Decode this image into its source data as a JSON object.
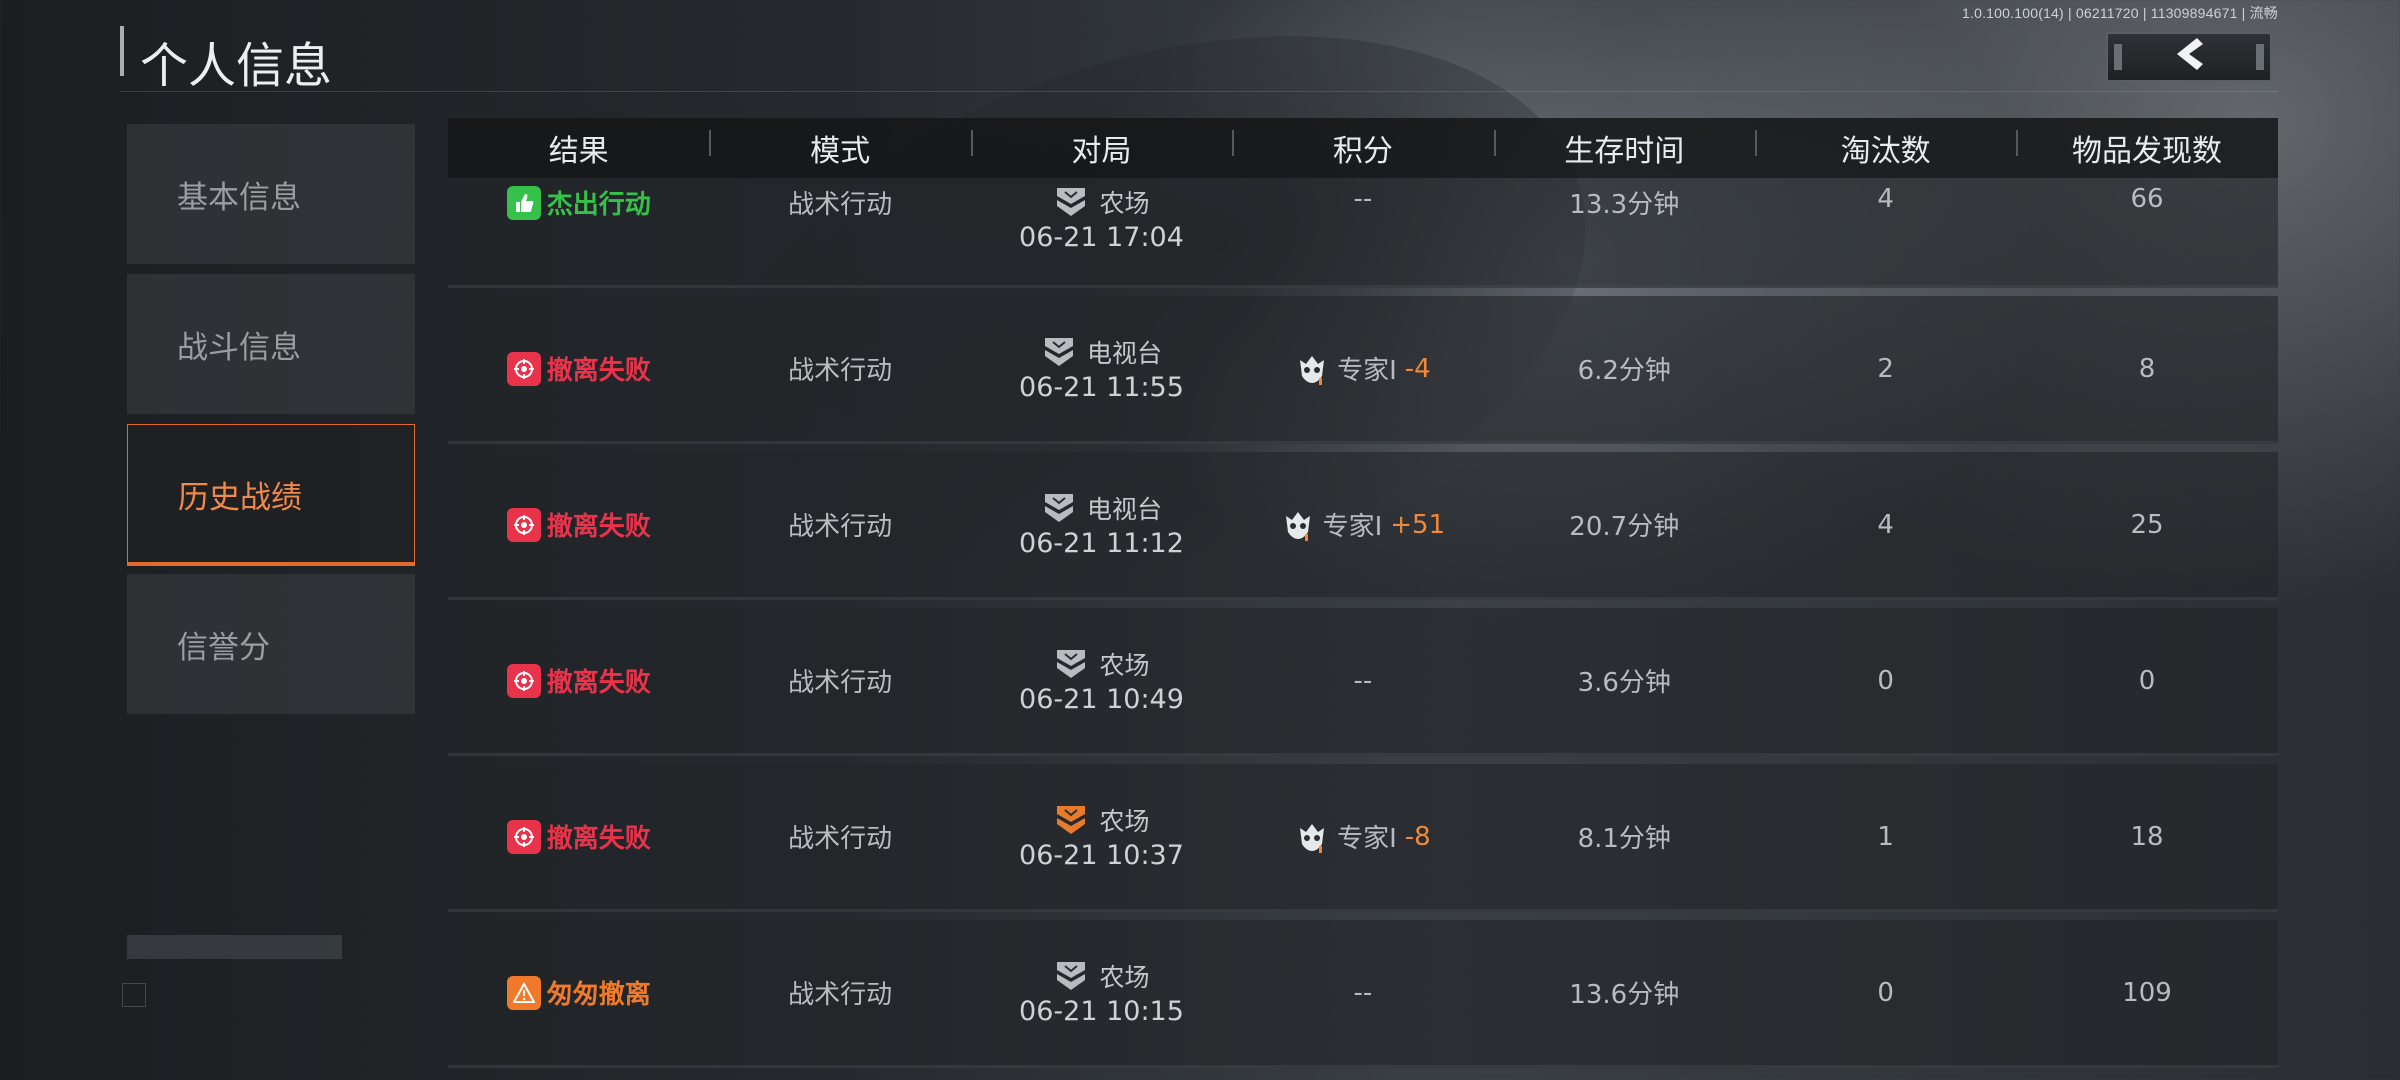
{
  "version_text": "1.0.100.100(14) | 06211720 | 11309894671 | 流畅",
  "header": {
    "title": "个人信息",
    "back_icon": "chevron-left-icon"
  },
  "sidebar": {
    "items": [
      {
        "label": "基本信息",
        "active": false
      },
      {
        "label": "战斗信息",
        "active": false
      },
      {
        "label": "历史战绩",
        "active": true
      },
      {
        "label": "信誉分",
        "active": false
      }
    ]
  },
  "table": {
    "headers": [
      "结果",
      "模式",
      "对局",
      "积分",
      "生存时间",
      "淘汰数",
      "物品发现数"
    ],
    "rows": [
      {
        "result": "杰出行动",
        "result_color": "#36c24a",
        "result_icon": "thumbs-up-icon",
        "mode": "战术行动",
        "map": "农场",
        "map_icon_color": "#b8bcc0",
        "time": "06-21 17:04",
        "score_rank": "",
        "score_delta": "",
        "score_text": "--",
        "survival": "13.3分钟",
        "kills": "4",
        "items": "66"
      },
      {
        "result": "撤离失败",
        "result_color": "#e8334a",
        "result_icon": "fail-icon",
        "mode": "战术行动",
        "map": "电视台",
        "map_icon_color": "#b8bcc0",
        "time": "06-21 11:55",
        "score_rank": "专家I",
        "score_delta": "-4",
        "score_text": "",
        "survival": "6.2分钟",
        "kills": "2",
        "items": "8"
      },
      {
        "result": "撤离失败",
        "result_color": "#e8334a",
        "result_icon": "fail-icon",
        "mode": "战术行动",
        "map": "电视台",
        "map_icon_color": "#b8bcc0",
        "time": "06-21 11:12",
        "score_rank": "专家I",
        "score_delta": "+51",
        "score_text": "",
        "survival": "20.7分钟",
        "kills": "4",
        "items": "25"
      },
      {
        "result": "撤离失败",
        "result_color": "#e8334a",
        "result_icon": "fail-icon",
        "mode": "战术行动",
        "map": "农场",
        "map_icon_color": "#b8bcc0",
        "time": "06-21 10:49",
        "score_rank": "",
        "score_delta": "",
        "score_text": "--",
        "survival": "3.6分钟",
        "kills": "0",
        "items": "0"
      },
      {
        "result": "撤离失败",
        "result_color": "#e8334a",
        "result_icon": "fail-icon",
        "mode": "战术行动",
        "map": "农场",
        "map_icon_color": "#e87a2c",
        "time": "06-21 10:37",
        "score_rank": "专家I",
        "score_delta": "-8",
        "score_text": "",
        "survival": "8.1分钟",
        "kills": "1",
        "items": "18"
      },
      {
        "result": "匆匆撤离",
        "result_color": "#f07a2a",
        "result_icon": "warning-icon",
        "mode": "战术行动",
        "map": "农场",
        "map_icon_color": "#b8bcc0",
        "time": "06-21 10:15",
        "score_rank": "",
        "score_delta": "",
        "score_text": "--",
        "survival": "13.6分钟",
        "kills": "0",
        "items": "109"
      }
    ]
  }
}
